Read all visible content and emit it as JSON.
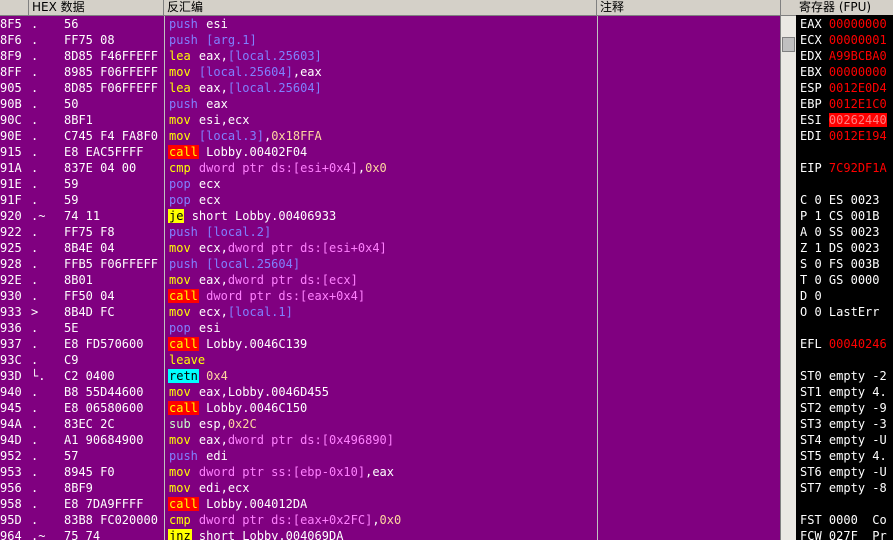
{
  "header": {
    "addr_col": "",
    "hex_col": "HEX 数据",
    "disasm_col": "反汇编",
    "comment_col": "注释",
    "registers_title": "寄存器 (FPU)"
  },
  "rows": [
    {
      "addr": "8F5",
      "mark": ".",
      "hex": "56",
      "mn": "push",
      "ops": [
        {
          "t": "esi",
          "k": "reg"
        }
      ]
    },
    {
      "addr": "8F6",
      "mark": ".",
      "hex": "FF75 08",
      "mn": "push",
      "ops": [
        {
          "t": "[arg.1]",
          "k": "mem"
        }
      ]
    },
    {
      "addr": "8F9",
      "mark": ".",
      "hex": "8D85 F46FFEFF",
      "mn": "lea",
      "ops": [
        {
          "t": "eax",
          "k": "reg"
        },
        {
          "t": ",",
          "k": "reg"
        },
        {
          "t": "[local.25603]",
          "k": "mem"
        }
      ]
    },
    {
      "addr": "8FF",
      "mark": ".",
      "hex": "8985 F06FFEFF",
      "mn": "mov",
      "ops": [
        {
          "t": "[local.25604]",
          "k": "mem"
        },
        {
          "t": ",eax",
          "k": "reg"
        }
      ]
    },
    {
      "addr": "905",
      "mark": ".",
      "hex": "8D85 F06FFEFF",
      "mn": "lea",
      "ops": [
        {
          "t": "eax",
          "k": "reg"
        },
        {
          "t": ",",
          "k": "reg"
        },
        {
          "t": "[local.25604]",
          "k": "mem"
        }
      ]
    },
    {
      "addr": "90B",
      "mark": ".",
      "hex": "50",
      "mn": "push",
      "ops": [
        {
          "t": "eax",
          "k": "reg"
        }
      ]
    },
    {
      "addr": "90C",
      "mark": ".",
      "hex": "8BF1",
      "mn": "mov",
      "ops": [
        {
          "t": "esi,ecx",
          "k": "reg"
        }
      ]
    },
    {
      "addr": "90E",
      "mark": ".",
      "hex": "C745 F4 FA8F0",
      "mn": "mov",
      "ops": [
        {
          "t": "[local.3]",
          "k": "mem"
        },
        {
          "t": ",",
          "k": "reg"
        },
        {
          "t": "0x18FFA",
          "k": "imm"
        }
      ]
    },
    {
      "addr": "915",
      "mark": ".",
      "hex": "E8 EAC5FFFF",
      "mn": "call",
      "ops": [
        {
          "t": "Lobby.00402F04",
          "k": "lbl"
        }
      ]
    },
    {
      "addr": "91A",
      "mark": ".",
      "hex": "837E 04 00",
      "mn": "cmp",
      "ops": [
        {
          "t": "dword ptr ds:[esi+0x4]",
          "k": "ptr"
        },
        {
          "t": ",",
          "k": "reg"
        },
        {
          "t": "0x0",
          "k": "imm"
        }
      ]
    },
    {
      "addr": "91E",
      "mark": ".",
      "hex": "59",
      "mn": "pop",
      "ops": [
        {
          "t": "ecx",
          "k": "reg"
        }
      ]
    },
    {
      "addr": "91F",
      "mark": ".",
      "hex": "59",
      "mn": "pop",
      "ops": [
        {
          "t": "ecx",
          "k": "reg"
        }
      ]
    },
    {
      "addr": "920",
      "mark": ".~",
      "hex": "74 11",
      "mn": "je",
      "ops": [
        {
          "t": "short Lobby.00406933",
          "k": "lbl"
        }
      ]
    },
    {
      "addr": "922",
      "mark": ".",
      "hex": "FF75 F8",
      "mn": "push",
      "ops": [
        {
          "t": "[local.2]",
          "k": "mem"
        }
      ]
    },
    {
      "addr": "925",
      "mark": ".",
      "hex": "8B4E 04",
      "mn": "mov",
      "ops": [
        {
          "t": "ecx,",
          "k": "reg"
        },
        {
          "t": "dword ptr ds:[esi+0x4]",
          "k": "ptr"
        }
      ]
    },
    {
      "addr": "928",
      "mark": ".",
      "hex": "FFB5 F06FFEFF",
      "mn": "push",
      "ops": [
        {
          "t": "[local.25604]",
          "k": "mem"
        }
      ]
    },
    {
      "addr": "92E",
      "mark": ".",
      "hex": "8B01",
      "mn": "mov",
      "ops": [
        {
          "t": "eax,",
          "k": "reg"
        },
        {
          "t": "dword ptr ds:[ecx]",
          "k": "ptr"
        }
      ]
    },
    {
      "addr": "930",
      "mark": ".",
      "hex": "FF50 04",
      "mn": "call",
      "ops": [
        {
          "t": "dword ptr ds:[eax+0x4]",
          "k": "ptr"
        }
      ]
    },
    {
      "addr": "933",
      "mark": ">",
      "hex": "8B4D FC",
      "mn": "mov",
      "ops": [
        {
          "t": "ecx,",
          "k": "reg"
        },
        {
          "t": "[local.1]",
          "k": "mem"
        }
      ]
    },
    {
      "addr": "936",
      "mark": ".",
      "hex": "5E",
      "mn": "pop",
      "ops": [
        {
          "t": "esi",
          "k": "reg"
        }
      ]
    },
    {
      "addr": "937",
      "mark": ".",
      "hex": "E8 FD570600",
      "mn": "call",
      "ops": [
        {
          "t": "Lobby.0046C139",
          "k": "lbl"
        }
      ]
    },
    {
      "addr": "93C",
      "mark": ".",
      "hex": "C9",
      "mn": "leave",
      "ops": []
    },
    {
      "addr": "93D",
      "mark": "└.",
      "hex": "C2 0400",
      "mn": "retn",
      "ops": [
        {
          "t": "0x4",
          "k": "imm"
        }
      ]
    },
    {
      "addr": "940",
      "mark": ".",
      "hex": "B8 55D44600",
      "mn": "mov",
      "ops": [
        {
          "t": "eax,Lobby.0046D455",
          "k": "reg"
        }
      ]
    },
    {
      "addr": "945",
      "mark": ".",
      "hex": "E8 06580600",
      "mn": "call",
      "ops": [
        {
          "t": "Lobby.0046C150",
          "k": "lbl"
        }
      ]
    },
    {
      "addr": "94A",
      "mark": ".",
      "hex": "83EC 2C",
      "mn": "sub",
      "ops": [
        {
          "t": "esp,",
          "k": "reg"
        },
        {
          "t": "0x2C",
          "k": "imm"
        }
      ]
    },
    {
      "addr": "94D",
      "mark": ".",
      "hex": "A1 90684900",
      "mn": "mov",
      "ops": [
        {
          "t": "eax,",
          "k": "reg"
        },
        {
          "t": "dword ptr ds:[0x496890]",
          "k": "ptr"
        }
      ]
    },
    {
      "addr": "952",
      "mark": ".",
      "hex": "57",
      "mn": "push",
      "ops": [
        {
          "t": "edi",
          "k": "reg"
        }
      ]
    },
    {
      "addr": "953",
      "mark": ".",
      "hex": "8945 F0",
      "mn": "mov",
      "ops": [
        {
          "t": "dword ptr ss:[ebp-0x10]",
          "k": "ptr"
        },
        {
          "t": ",eax",
          "k": "reg"
        }
      ]
    },
    {
      "addr": "956",
      "mark": ".",
      "hex": "8BF9",
      "mn": "mov",
      "ops": [
        {
          "t": "edi,ecx",
          "k": "reg"
        }
      ]
    },
    {
      "addr": "958",
      "mark": ".",
      "hex": "E8 7DA9FFFF",
      "mn": "call",
      "ops": [
        {
          "t": "Lobby.004012DA",
          "k": "lbl"
        }
      ]
    },
    {
      "addr": "95D",
      "mark": ".",
      "hex": "83B8 FC020000",
      "mn": "cmp",
      "ops": [
        {
          "t": "dword ptr ds:[eax+0x2FC]",
          "k": "ptr"
        },
        {
          "t": ",",
          "k": "reg"
        },
        {
          "t": "0x0",
          "k": "imm"
        }
      ]
    },
    {
      "addr": "964",
      "mark": ".~",
      "hex": "75 74",
      "mn": "jnz",
      "ops": [
        {
          "t": "short Lobby.004069DA",
          "k": "lbl"
        }
      ]
    }
  ],
  "registers": [
    {
      "row": 0,
      "name": "EAX",
      "val": "00000000",
      "style": ""
    },
    {
      "row": 1,
      "name": "ECX",
      "val": "00000001",
      "style": ""
    },
    {
      "row": 2,
      "name": "EDX",
      "val": "A99BCBA0",
      "style": ""
    },
    {
      "row": 3,
      "name": "EBX",
      "val": "00000000",
      "style": ""
    },
    {
      "row": 4,
      "name": "ESP",
      "val": "0012E0D4",
      "style": ""
    },
    {
      "row": 5,
      "name": "EBP",
      "val": "0012E1C0",
      "style": ""
    },
    {
      "row": 6,
      "name": "ESI",
      "val": "00262440",
      "style": "hl"
    },
    {
      "row": 7,
      "name": "EDI",
      "val": "0012E194",
      "style": ""
    },
    {
      "row": 9,
      "name": "EIP",
      "val": "7C92DF1A",
      "style": ""
    },
    {
      "row": 11,
      "name": "C 0",
      "val": "ES 0023",
      "style": "w"
    },
    {
      "row": 12,
      "name": "P 1",
      "val": "CS 001B",
      "style": "w"
    },
    {
      "row": 13,
      "name": "A 0",
      "val": "SS 0023",
      "style": "w"
    },
    {
      "row": 14,
      "name": "Z 1",
      "val": "DS 0023",
      "style": "wz"
    },
    {
      "row": 15,
      "name": "S 0",
      "val": "FS 003B",
      "style": "w"
    },
    {
      "row": 16,
      "name": "T 0",
      "val": "GS 0000",
      "style": "w"
    },
    {
      "row": 17,
      "name": "D 0",
      "val": "",
      "style": "w"
    },
    {
      "row": 18,
      "name": "O 0",
      "val": "LastErr",
      "style": "w"
    },
    {
      "row": 20,
      "name": "EFL",
      "val": "00040246",
      "style": ""
    },
    {
      "row": 22,
      "name": "ST0",
      "val": "empty -2",
      "style": "st"
    },
    {
      "row": 23,
      "name": "ST1",
      "val": "empty 4.",
      "style": "st"
    },
    {
      "row": 24,
      "name": "ST2",
      "val": "empty -9",
      "style": "st"
    },
    {
      "row": 25,
      "name": "ST3",
      "val": "empty -3",
      "style": "st"
    },
    {
      "row": 26,
      "name": "ST4",
      "val": "empty -U",
      "style": "st"
    },
    {
      "row": 27,
      "name": "ST5",
      "val": "empty 4.",
      "style": "st"
    },
    {
      "row": 28,
      "name": "ST6",
      "val": "empty -U",
      "style": "st"
    },
    {
      "row": 29,
      "name": "ST7",
      "val": "empty -8",
      "style": "st"
    },
    {
      "row": 31,
      "name": "FST",
      "val": "0000  Co",
      "style": "w"
    },
    {
      "row": 32,
      "name": "FCW",
      "val": "027F  Pr",
      "style": "w"
    }
  ]
}
